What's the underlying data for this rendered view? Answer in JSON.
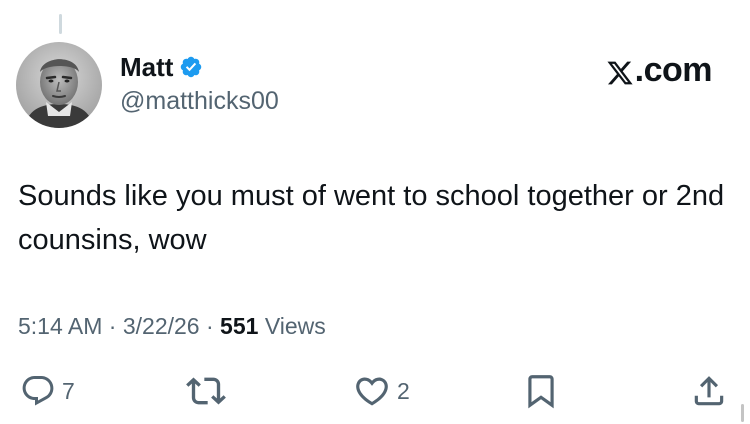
{
  "author": {
    "display_name": "Matt",
    "handle": "@matthicks00",
    "verified": true,
    "avatar": "profile-photo"
  },
  "brand": {
    "label": ".com",
    "icon": "x-logo-icon"
  },
  "tweet": {
    "text": "Sounds like you must of went to school together or 2nd counsins, wow",
    "time": "5:14 AM",
    "date": "3/22/26",
    "separator": "·",
    "views_count": "551",
    "views_label": "Views"
  },
  "actions": {
    "reply": {
      "icon": "reply-icon",
      "count": "7"
    },
    "repost": {
      "icon": "repost-icon",
      "count": ""
    },
    "like": {
      "icon": "heart-icon",
      "count": "2"
    },
    "bookmark": {
      "icon": "bookmark-icon",
      "count": ""
    },
    "share": {
      "icon": "share-icon",
      "count": ""
    }
  },
  "colors": {
    "text": "#0f1419",
    "secondary": "#536471",
    "verified": "#1d9bf0",
    "background": "#ffffff"
  }
}
